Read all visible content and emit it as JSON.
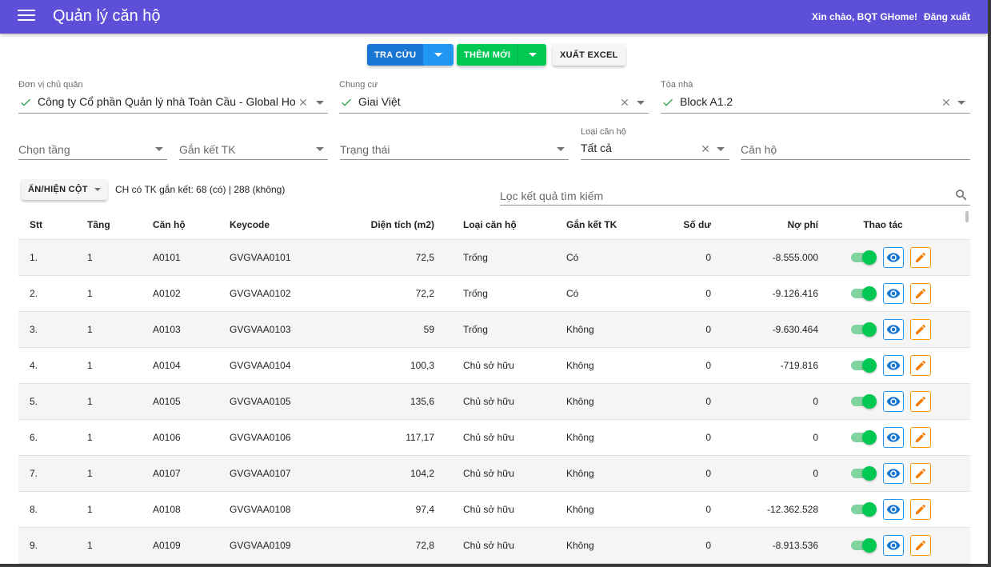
{
  "header": {
    "title": "Quản lý căn hộ",
    "greeting": "Xin chào, BQT GHome!",
    "logout": "Đăng xuất"
  },
  "toolbar": {
    "search_label": "TRA CỨU",
    "add_label": "THÊM MỚI",
    "export_label": "XUẤT EXCEL"
  },
  "filters": {
    "owner": {
      "label": "Đơn vị chủ quản",
      "value": "Công ty Cổ phần Quản lý nhà Toàn Cầu - Global Ho"
    },
    "complex": {
      "label": "Chung cư",
      "value": "Giai Việt"
    },
    "building": {
      "label": "Tòa nhà",
      "value": "Block A1.2"
    },
    "floor": {
      "placeholder": "Chọn tầng"
    },
    "link": {
      "placeholder": "Gắn kết TK"
    },
    "status": {
      "placeholder": "Trạng thái"
    },
    "type": {
      "label": "Loại căn hộ",
      "value": "Tất cả"
    },
    "apartment": {
      "placeholder": "Căn hộ"
    }
  },
  "columns_button": "ẨN/HIỆN CỘT",
  "summary": "CH có TK gắn kết: 68 (có) | 288 (không)",
  "search": {
    "placeholder": "Lọc kết quả tìm kiếm"
  },
  "colors": {
    "appbar": "#5d4fd8",
    "primary": "#1976d2",
    "success": "#00c853",
    "warning": "#ff9800"
  },
  "table": {
    "headers": {
      "stt": "Stt",
      "floor": "Tầng",
      "apt": "Căn hộ",
      "keycode": "Keycode",
      "area": "Diện tích (m2)",
      "type": "Loại căn hộ",
      "link": "Gắn kết TK",
      "balance": "Số dư",
      "debt": "Nợ phí",
      "actions": "Thao tác"
    },
    "rows": [
      {
        "stt": "1.",
        "floor": "1",
        "apt": "A0101",
        "keycode": "GVGVAA0101",
        "area": "72,5",
        "type": "Trống",
        "link": "Có",
        "balance": "0",
        "debt": "-8.555.000"
      },
      {
        "stt": "2.",
        "floor": "1",
        "apt": "A0102",
        "keycode": "GVGVAA0102",
        "area": "72,2",
        "type": "Trống",
        "link": "Có",
        "balance": "0",
        "debt": "-9.126.416"
      },
      {
        "stt": "3.",
        "floor": "1",
        "apt": "A0103",
        "keycode": "GVGVAA0103",
        "area": "59",
        "type": "Trống",
        "link": "Không",
        "balance": "0",
        "debt": "-9.630.464"
      },
      {
        "stt": "4.",
        "floor": "1",
        "apt": "A0104",
        "keycode": "GVGVAA0104",
        "area": "100,3",
        "type": "Chủ sở hữu",
        "link": "Không",
        "balance": "0",
        "debt": "-719.816"
      },
      {
        "stt": "5.",
        "floor": "1",
        "apt": "A0105",
        "keycode": "GVGVAA0105",
        "area": "135,6",
        "type": "Chủ sở hữu",
        "link": "Không",
        "balance": "0",
        "debt": "0"
      },
      {
        "stt": "6.",
        "floor": "1",
        "apt": "A0106",
        "keycode": "GVGVAA0106",
        "area": "117,17",
        "type": "Chủ sở hữu",
        "link": "Không",
        "balance": "0",
        "debt": "0"
      },
      {
        "stt": "7.",
        "floor": "1",
        "apt": "A0107",
        "keycode": "GVGVAA0107",
        "area": "104,2",
        "type": "Chủ sở hữu",
        "link": "Không",
        "balance": "0",
        "debt": "0"
      },
      {
        "stt": "8.",
        "floor": "1",
        "apt": "A0108",
        "keycode": "GVGVAA0108",
        "area": "97,4",
        "type": "Chủ sở hữu",
        "link": "Không",
        "balance": "0",
        "debt": "-12.362.528"
      },
      {
        "stt": "9.",
        "floor": "1",
        "apt": "A0109",
        "keycode": "GVGVAA0109",
        "area": "72,8",
        "type": "Chủ sở hữu",
        "link": "Không",
        "balance": "0",
        "debt": "-8.913.536"
      }
    ]
  }
}
